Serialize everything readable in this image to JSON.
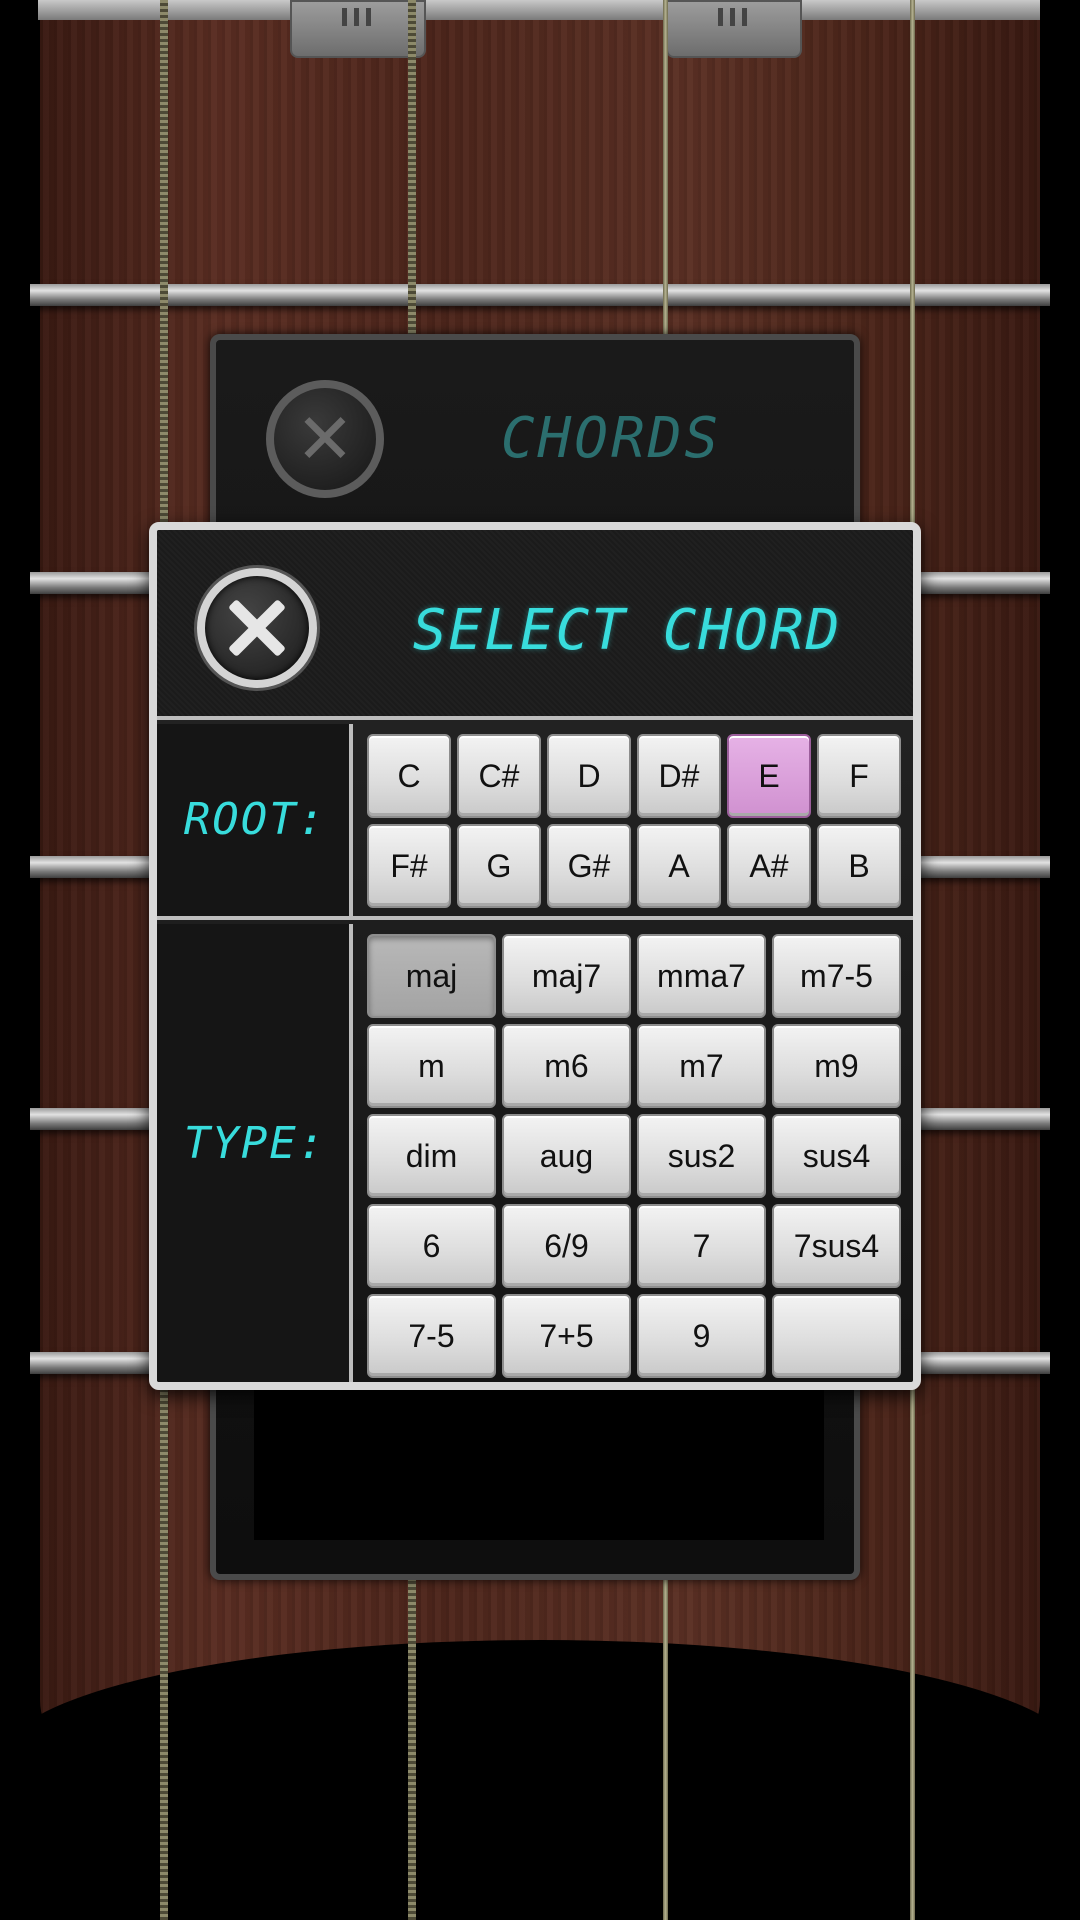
{
  "background_panel": {
    "title": "CHORDS",
    "close_glyph": "✕"
  },
  "dialog": {
    "title": "SELECT CHORD",
    "root_label": "ROOT:",
    "type_label": "TYPE:",
    "selected_root": "E",
    "selected_type": "maj",
    "root_notes": [
      "C",
      "C#",
      "D",
      "D#",
      "E",
      "F",
      "F#",
      "G",
      "G#",
      "A",
      "A#",
      "B"
    ],
    "types": [
      "maj",
      "maj7",
      "mma7",
      "m7-5",
      "m",
      "m6",
      "m7",
      "m9",
      "dim",
      "aug",
      "sus2",
      "sus4",
      "6",
      "6/9",
      "7",
      "7sus4",
      "7-5",
      "7+5",
      "9",
      ""
    ]
  },
  "colors": {
    "accent_cyan": "#38dcdc",
    "selected_root": "#d9a0d9",
    "wood": "#5a2d22"
  },
  "icons": {
    "close": "close-icon"
  }
}
